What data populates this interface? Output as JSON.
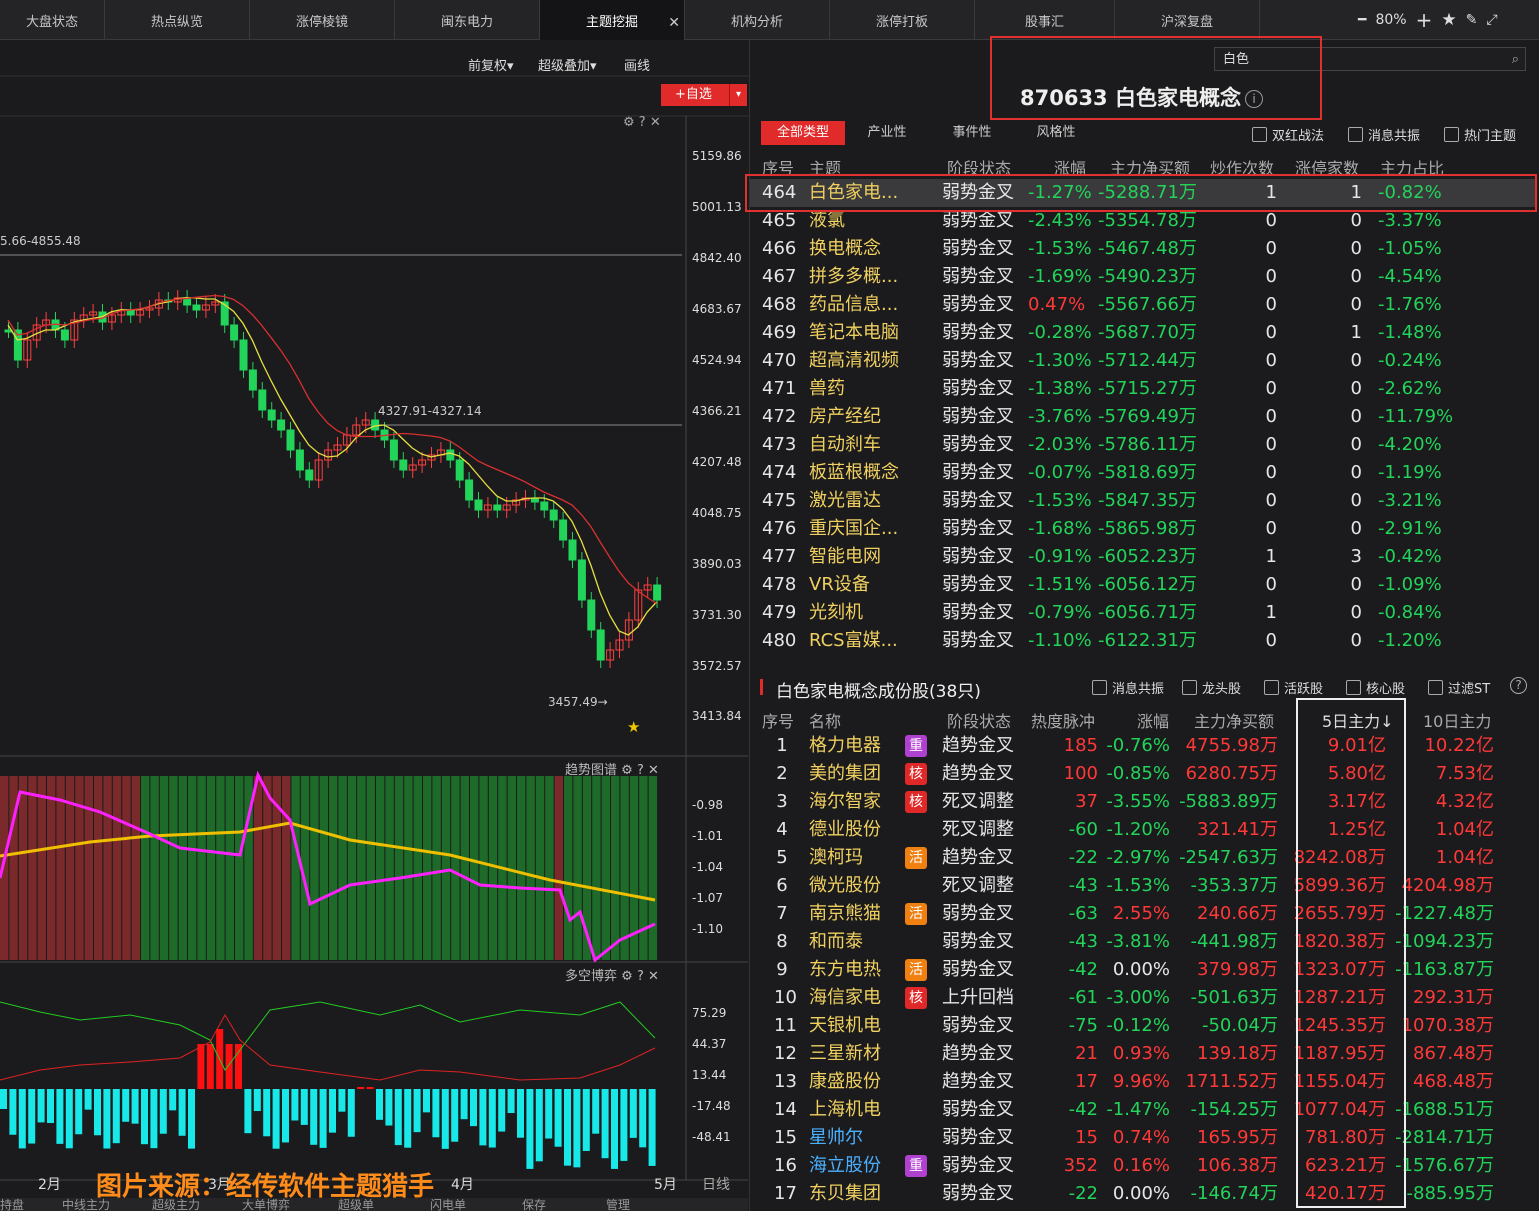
{
  "tabs": [
    {
      "label": "大盘状态"
    },
    {
      "label": "热点纵览"
    },
    {
      "label": "涨停棱镜"
    },
    {
      "label": "闽东电力"
    },
    {
      "label": "主题挖掘"
    },
    {
      "label": "机构分析"
    },
    {
      "label": "涨停打板"
    },
    {
      "label": "股事汇"
    },
    {
      "label": "沪深复盘"
    }
  ],
  "zoom": "80%",
  "toolbar": {
    "adjust": "前复权▾",
    "overlay": "超级叠加▾",
    "draw": "画线",
    "add_watch": "+自选",
    "add_watch_arrow": "▾"
  },
  "price_axis": [
    "5159.86",
    "5001.13",
    "4842.40",
    "4683.67",
    "4524.94",
    "4366.21",
    "4207.48",
    "4048.75",
    "3890.03",
    "3731.30",
    "3572.57",
    "3413.84"
  ],
  "annotations": {
    "high_line": "5.66-4855.48",
    "mid_line": "4327.91-4327.14",
    "low_label": "3457.49→"
  },
  "trend_panel": {
    "title": "趋势图谱",
    "axis": [
      "-0.98",
      "-1.01",
      "-1.04",
      "-1.07",
      "-1.10"
    ]
  },
  "bull_panel": {
    "title": "多空博弈",
    "axis": [
      "75.29",
      "44.37",
      "13.44",
      "-17.48",
      "-48.41"
    ]
  },
  "months": [
    "2月",
    "3月",
    "4月",
    "5月"
  ],
  "day_label": "日线",
  "watermark": "图片来源：经传软件主题猎手",
  "bottom_tabs": [
    "持盘",
    "中线主力",
    "超级主力",
    "大单博弈",
    "超级单",
    "闪电单",
    "保存",
    "管理"
  ],
  "search": {
    "value": "白色"
  },
  "topic": {
    "code": "870633",
    "name": "白色家电概念"
  },
  "filter_tabs": [
    "全部类型",
    "产业性",
    "事件性",
    "风格性"
  ],
  "filter_checks": [
    "双红战法",
    "消息共振",
    "热门主题"
  ],
  "topic_headers": [
    "序号",
    "主题",
    "阶段状态",
    "涨幅",
    "主力净买额",
    "炒作次数",
    "涨停家数",
    "主力占比"
  ],
  "topic_rows": [
    {
      "no": "464",
      "name": "白色家电...",
      "stage": "弱势金叉",
      "chg": "-1.27%",
      "net": "-5288.71万",
      "times": "1",
      "limit": "1",
      "ratio": "-0.82%"
    },
    {
      "no": "465",
      "name": "液氯",
      "stage": "弱势金叉",
      "chg": "-2.43%",
      "net": "-5354.78万",
      "times": "0",
      "limit": "0",
      "ratio": "-3.37%"
    },
    {
      "no": "466",
      "name": "换电概念",
      "stage": "弱势金叉",
      "chg": "-1.53%",
      "net": "-5467.48万",
      "times": "0",
      "limit": "0",
      "ratio": "-1.05%"
    },
    {
      "no": "467",
      "name": "拼多多概...",
      "stage": "弱势金叉",
      "chg": "-1.69%",
      "net": "-5490.23万",
      "times": "0",
      "limit": "0",
      "ratio": "-4.54%"
    },
    {
      "no": "468",
      "name": "药品信息...",
      "stage": "弱势金叉",
      "chg": "0.47%",
      "net": "-5567.66万",
      "times": "0",
      "limit": "0",
      "ratio": "-1.76%"
    },
    {
      "no": "469",
      "name": "笔记本电脑",
      "stage": "弱势金叉",
      "chg": "-0.28%",
      "net": "-5687.70万",
      "times": "0",
      "limit": "1",
      "ratio": "-1.48%"
    },
    {
      "no": "470",
      "name": "超高清视频",
      "stage": "弱势金叉",
      "chg": "-1.30%",
      "net": "-5712.44万",
      "times": "0",
      "limit": "0",
      "ratio": "-0.24%"
    },
    {
      "no": "471",
      "name": "兽药",
      "stage": "弱势金叉",
      "chg": "-1.38%",
      "net": "-5715.27万",
      "times": "0",
      "limit": "0",
      "ratio": "-2.62%"
    },
    {
      "no": "472",
      "name": "房产经纪",
      "stage": "弱势金叉",
      "chg": "-3.76%",
      "net": "-5769.49万",
      "times": "0",
      "limit": "0",
      "ratio": "-11.79%"
    },
    {
      "no": "473",
      "name": "自动刹车",
      "stage": "弱势金叉",
      "chg": "-2.03%",
      "net": "-5786.11万",
      "times": "0",
      "limit": "0",
      "ratio": "-4.20%"
    },
    {
      "no": "474",
      "name": "板蓝根概念",
      "stage": "弱势金叉",
      "chg": "-0.07%",
      "net": "-5818.69万",
      "times": "0",
      "limit": "0",
      "ratio": "-1.19%"
    },
    {
      "no": "475",
      "name": "激光雷达",
      "stage": "弱势金叉",
      "chg": "-1.53%",
      "net": "-5847.35万",
      "times": "0",
      "limit": "0",
      "ratio": "-3.21%"
    },
    {
      "no": "476",
      "name": "重庆国企...",
      "stage": "弱势金叉",
      "chg": "-1.68%",
      "net": "-5865.98万",
      "times": "0",
      "limit": "0",
      "ratio": "-2.91%"
    },
    {
      "no": "477",
      "name": "智能电网",
      "stage": "弱势金叉",
      "chg": "-0.91%",
      "net": "-6052.23万",
      "times": "1",
      "limit": "3",
      "ratio": "-0.42%"
    },
    {
      "no": "478",
      "name": "VR设备",
      "stage": "弱势金叉",
      "chg": "-1.51%",
      "net": "-6056.12万",
      "times": "0",
      "limit": "0",
      "ratio": "-1.09%"
    },
    {
      "no": "479",
      "name": "光刻机",
      "stage": "弱势金叉",
      "chg": "-0.79%",
      "net": "-6056.71万",
      "times": "1",
      "limit": "0",
      "ratio": "-0.84%"
    },
    {
      "no": "480",
      "name": "RCS富媒...",
      "stage": "弱势金叉",
      "chg": "-1.10%",
      "net": "-6122.31万",
      "times": "0",
      "limit": "0",
      "ratio": "-1.20%"
    }
  ],
  "stocks_title": "白色家电概念成份股(38只)",
  "stock_checks": [
    "消息共振",
    "龙头股",
    "活跃股",
    "核心股",
    "过滤ST"
  ],
  "stock_headers": [
    "序号",
    "名称",
    "阶段状态",
    "热度脉冲",
    "涨幅",
    "主力净买额",
    "5日主力↓",
    "10日主力"
  ],
  "stock_rows": [
    {
      "no": "1",
      "name": "格力电器",
      "tag": "重",
      "stage": "趋势金叉",
      "heat": "185",
      "chg": "-0.76%",
      "net": "4755.98万",
      "d5": "9.01亿",
      "d10": "10.22亿"
    },
    {
      "no": "2",
      "name": "美的集团",
      "tag": "核",
      "stage": "趋势金叉",
      "heat": "100",
      "chg": "-0.85%",
      "net": "6280.75万",
      "d5": "5.80亿",
      "d10": "7.53亿"
    },
    {
      "no": "3",
      "name": "海尔智家",
      "tag": "核",
      "stage": "死叉调整",
      "heat": "37",
      "chg": "-3.55%",
      "net": "-5883.89万",
      "d5": "3.17亿",
      "d10": "4.32亿"
    },
    {
      "no": "4",
      "name": "德业股份",
      "tag": "",
      "stage": "死叉调整",
      "heat": "-60",
      "chg": "-1.20%",
      "net": "321.41万",
      "d5": "1.25亿",
      "d10": "1.04亿"
    },
    {
      "no": "5",
      "name": "澳柯玛",
      "tag": "活",
      "stage": "趋势金叉",
      "heat": "-22",
      "chg": "-2.97%",
      "net": "-2547.63万",
      "d5": "8242.08万",
      "d10": "1.04亿"
    },
    {
      "no": "6",
      "name": "微光股份",
      "tag": "",
      "stage": "死叉调整",
      "heat": "-43",
      "chg": "-1.53%",
      "net": "-353.37万",
      "d5": "5899.36万",
      "d10": "4204.98万"
    },
    {
      "no": "7",
      "name": "南京熊猫",
      "tag": "活",
      "stage": "弱势金叉",
      "heat": "-63",
      "chg": "2.55%",
      "net": "240.66万",
      "d5": "2655.79万",
      "d10": "-1227.48万"
    },
    {
      "no": "8",
      "name": "和而泰",
      "tag": "",
      "stage": "弱势金叉",
      "heat": "-43",
      "chg": "-3.81%",
      "net": "-441.98万",
      "d5": "1820.38万",
      "d10": "-1094.23万"
    },
    {
      "no": "9",
      "name": "东方电热",
      "tag": "活",
      "stage": "弱势金叉",
      "heat": "-42",
      "chg": "0.00%",
      "net": "379.98万",
      "d5": "1323.07万",
      "d10": "-1163.87万"
    },
    {
      "no": "10",
      "name": "海信家电",
      "tag": "核",
      "stage": "上升回档",
      "heat": "-61",
      "chg": "-3.00%",
      "net": "-501.63万",
      "d5": "1287.21万",
      "d10": "292.31万"
    },
    {
      "no": "11",
      "name": "天银机电",
      "tag": "",
      "stage": "弱势金叉",
      "heat": "-75",
      "chg": "-0.12%",
      "net": "-50.04万",
      "d5": "1245.35万",
      "d10": "1070.38万"
    },
    {
      "no": "12",
      "name": "三星新材",
      "tag": "",
      "stage": "趋势金叉",
      "heat": "21",
      "chg": "0.93%",
      "net": "139.18万",
      "d5": "1187.95万",
      "d10": "867.48万"
    },
    {
      "no": "13",
      "name": "康盛股份",
      "tag": "",
      "stage": "趋势金叉",
      "heat": "17",
      "chg": "9.96%",
      "net": "1711.52万",
      "d5": "1155.04万",
      "d10": "468.48万"
    },
    {
      "no": "14",
      "name": "上海机电",
      "tag": "",
      "stage": "弱势金叉",
      "heat": "-42",
      "chg": "-1.47%",
      "net": "-154.25万",
      "d5": "1077.04万",
      "d10": "-1688.51万"
    },
    {
      "no": "15",
      "name": "星帅尔",
      "tag": "",
      "stage": "弱势金叉",
      "heat": "15",
      "chg": "0.74%",
      "net": "165.95万",
      "d5": "781.80万",
      "d10": "-2814.71万"
    },
    {
      "no": "16",
      "name": "海立股份",
      "tag": "重",
      "stage": "弱势金叉",
      "heat": "352",
      "chg": "0.16%",
      "net": "106.38万",
      "d5": "623.21万",
      "d10": "-1576.67万"
    },
    {
      "no": "17",
      "name": "东贝集团",
      "tag": "",
      "stage": "弱势金叉",
      "heat": "-22",
      "chg": "0.00%",
      "net": "-146.74万",
      "d5": "420.17万",
      "d10": "-885.95万"
    }
  ]
}
